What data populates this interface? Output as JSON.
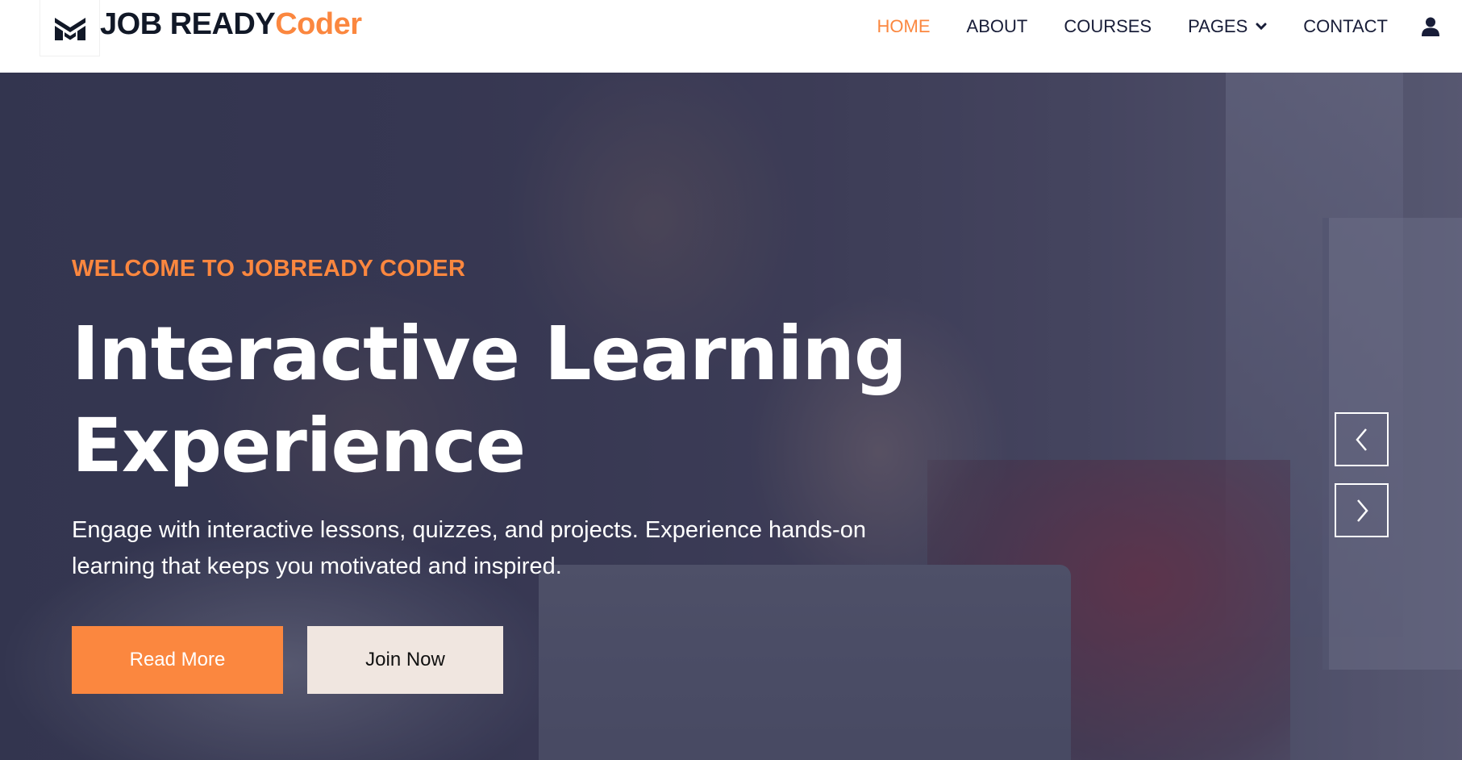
{
  "brand": {
    "part1": "JOB READY",
    "part2": "Coder",
    "logo_icon": "m-logo-icon"
  },
  "nav": {
    "items": [
      {
        "label": "HOME",
        "active": true
      },
      {
        "label": "ABOUT",
        "active": false
      },
      {
        "label": "COURSES",
        "active": false
      },
      {
        "label": "PAGES",
        "active": false,
        "dropdown": true
      },
      {
        "label": "CONTACT",
        "active": false
      }
    ],
    "user_icon": "user-icon"
  },
  "hero": {
    "kicker": "WELCOME TO JOBREADY CODER",
    "headline_line1": "Interactive Learning",
    "headline_line2": "Experience",
    "description_line1": "Engage with interactive lessons, quizzes, and projects. Experience hands-on",
    "description_line2": "learning that keeps you motivated and inspired.",
    "primary_button": "Read More",
    "secondary_button": "Join Now",
    "prev_icon": "chevron-left-icon",
    "next_icon": "chevron-right-icon"
  },
  "colors": {
    "accent": "#fb873f",
    "dark_text": "#181d38",
    "secondary_button_bg": "#f0e6e0"
  }
}
